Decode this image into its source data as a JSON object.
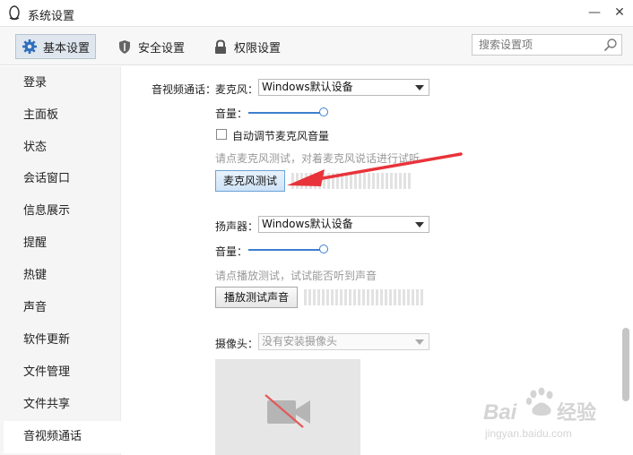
{
  "window": {
    "title": "系统设置",
    "minimize_symbol": "—",
    "close_symbol": "✕"
  },
  "toolbar": {
    "tabs": [
      {
        "label": "基本设置",
        "icon": "gear-icon",
        "active": true
      },
      {
        "label": "安全设置",
        "icon": "shield-icon",
        "active": false
      },
      {
        "label": "权限设置",
        "icon": "lock-icon",
        "active": false
      }
    ],
    "search_placeholder": "搜索设置项"
  },
  "sidebar": {
    "items": [
      {
        "label": "登录"
      },
      {
        "label": "主面板"
      },
      {
        "label": "状态"
      },
      {
        "label": "会话窗口"
      },
      {
        "label": "信息展示"
      },
      {
        "label": "提醒"
      },
      {
        "label": "热键"
      },
      {
        "label": "声音"
      },
      {
        "label": "软件更新"
      },
      {
        "label": "文件管理"
      },
      {
        "label": "文件共享"
      },
      {
        "label": "音视频通话"
      }
    ],
    "active_index": 11
  },
  "av": {
    "section_label": "音视频通话：",
    "mic": {
      "label": "麦克风：",
      "device": "Windows默认设备",
      "volume_label": "音量：",
      "volume_level": 1.0,
      "auto_adjust_label": "自动调节麦克风音量",
      "auto_adjust_checked": false,
      "hint": "请点麦克风测试，对着麦克风说话进行试听",
      "test_button": "麦克风测试"
    },
    "speaker": {
      "label": "扬声器：",
      "device": "Windows默认设备",
      "volume_label": "音量：",
      "volume_level": 1.0,
      "hint": "请点播放测试，试试能否听到声音",
      "test_button": "播放测试声音"
    },
    "camera": {
      "label": "摄像头：",
      "device": "没有安装摄像头"
    }
  },
  "watermark": {
    "brand": "Baidu经验",
    "url": "jingyan.baidu.com"
  },
  "colors": {
    "accent": "#3d7fce",
    "annotation_arrow": "#e8333a",
    "toolbar_active_bg": "#dfe6ee"
  }
}
